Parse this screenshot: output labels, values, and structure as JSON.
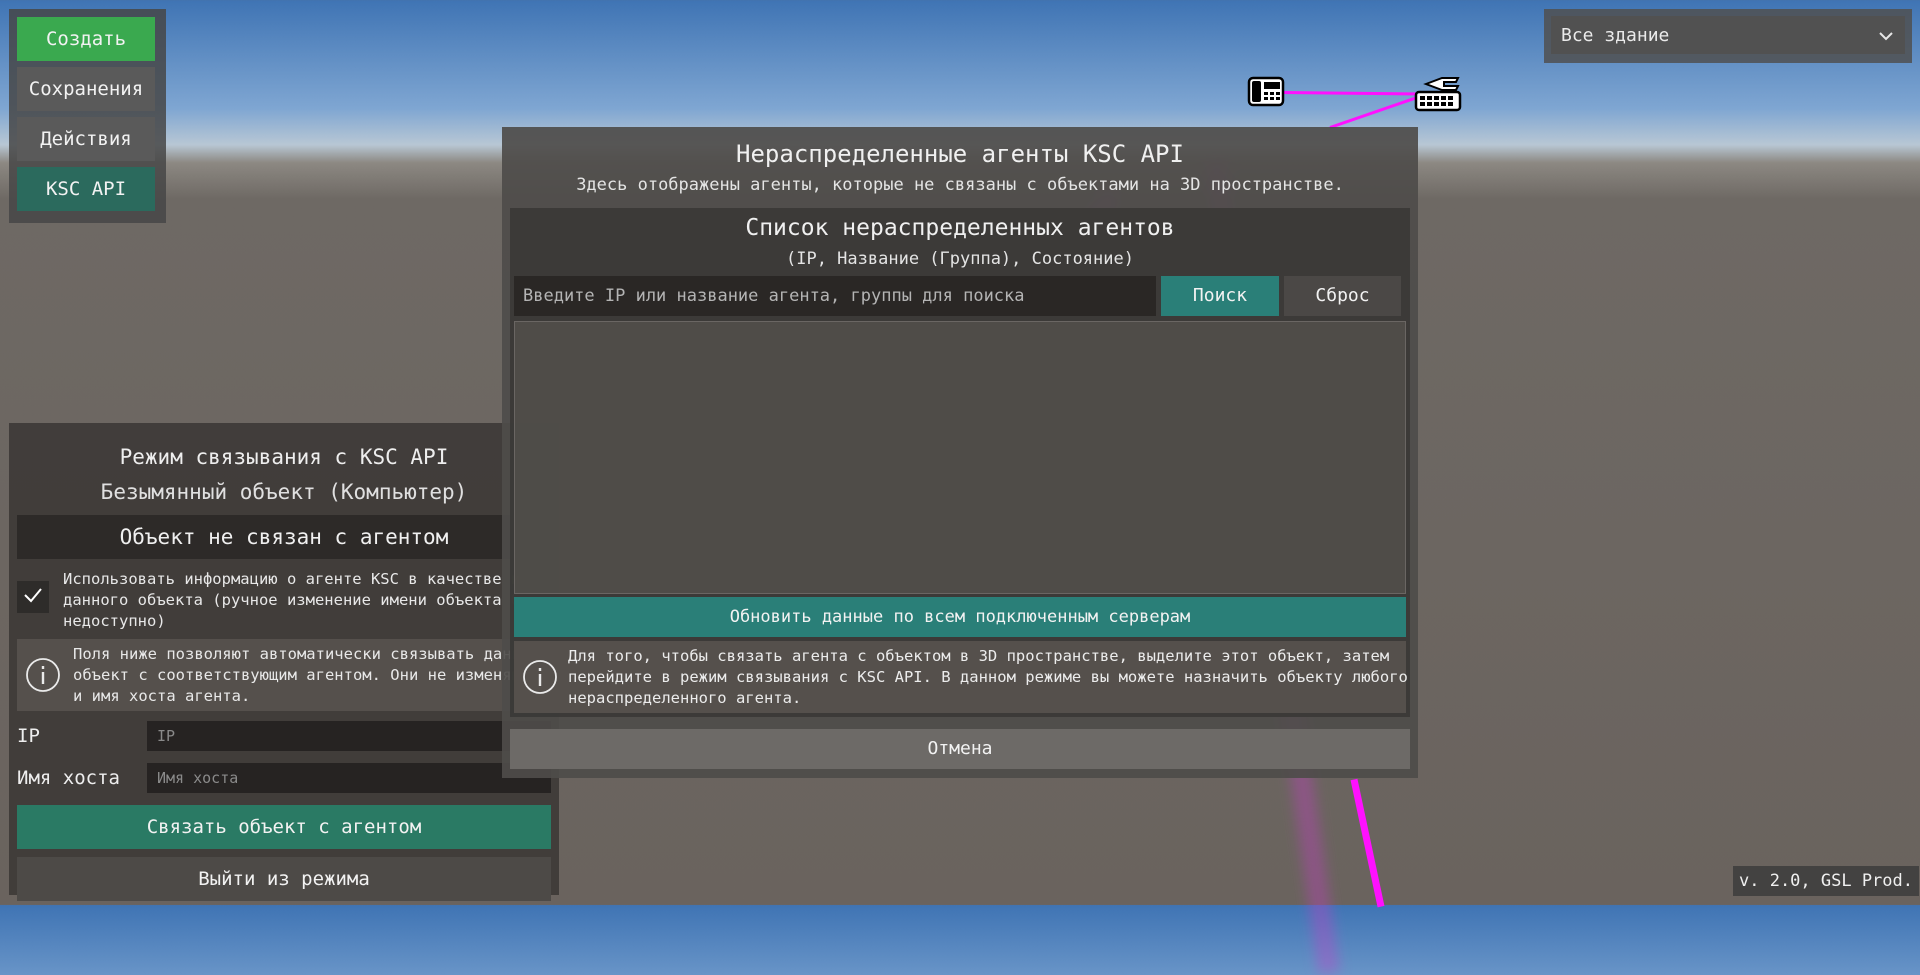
{
  "menu": {
    "create": "Создать",
    "saves": "Сохранения",
    "actions": "Действия",
    "ksc_api": "KSC API"
  },
  "scope": {
    "selected": "Все здание"
  },
  "bind_panel": {
    "title": "Режим связывания с KSC API",
    "object_name": "Безымянный объект (Компьютер)",
    "status": "Объект не связан с агентом",
    "checkbox_text": "Использовать информацию о агенте KSC в качестве и\nданного объекта (ручное изменение имени объекта б\nнедоступно)",
    "info_text": "Поля ниже позволяют автоматически связывать данн\nобъект с соответствующим агентом. Они не изменяю\nи имя хоста агента.",
    "ip_label": "IP",
    "ip_placeholder": "IP",
    "host_label": "Имя хоста",
    "host_placeholder": "Имя хоста",
    "link_button": "Связать объект с агентом",
    "exit_button": "Выйти из режима"
  },
  "modal": {
    "title": "Нераспределенные агенты KSC API",
    "subtitle": "Здесь отображены агенты, которые не связаны с объектами на 3D пространстве.",
    "list_title": "Список нераспределенных агентов",
    "list_columns": "(IP, Название (Группа), Состояние)",
    "search_placeholder": "Введите IP или название агента, группы для поиска",
    "search_button": "Поиск",
    "reset_button": "Сброс",
    "refresh_button": "Обновить данные по всем подключенным серверам",
    "info_text": "Для того, чтобы связать агента с объектом в 3D пространстве, выделите этот объект, затем\nперейдите в режим связывания с KSC API. В данном режиме вы можете назначить объекту любого\nнераспределенного агента.",
    "cancel_button": "Отмена"
  },
  "version": "v. 2.0, GSL Prod."
}
